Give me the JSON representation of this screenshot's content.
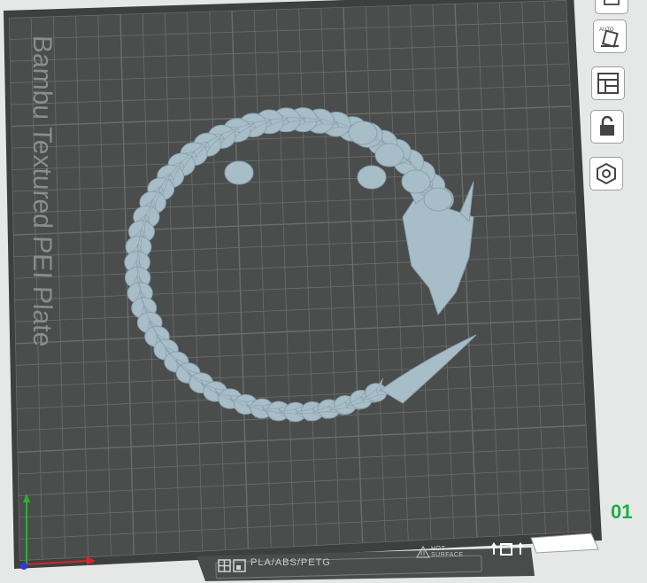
{
  "plate": {
    "name": "Bambu Textured PEI Plate",
    "number": "01",
    "filament_types": "PLA/ABS/PETG",
    "surface_line1": "HOT",
    "surface_line2": "SURFACE"
  },
  "toolbar": {
    "buttons": [
      {
        "id": "top-partial",
        "icon": "partial-icon"
      },
      {
        "id": "auto-orient",
        "icon": "auto-orient-icon",
        "text": "AUTO"
      },
      {
        "id": "arrange",
        "icon": "arrange-icon"
      },
      {
        "id": "lock",
        "icon": "unlock-icon"
      },
      {
        "id": "settings",
        "icon": "hexagon-nut-icon"
      }
    ]
  },
  "colors": {
    "bed": "#4b4d4d",
    "grid": "#6a6d6d",
    "model": "#a7bec8",
    "axis_x": "#d62727",
    "axis_y": "#2ab32a",
    "axis_z": "#2b3bd6",
    "plate_number": "#1dae42"
  }
}
